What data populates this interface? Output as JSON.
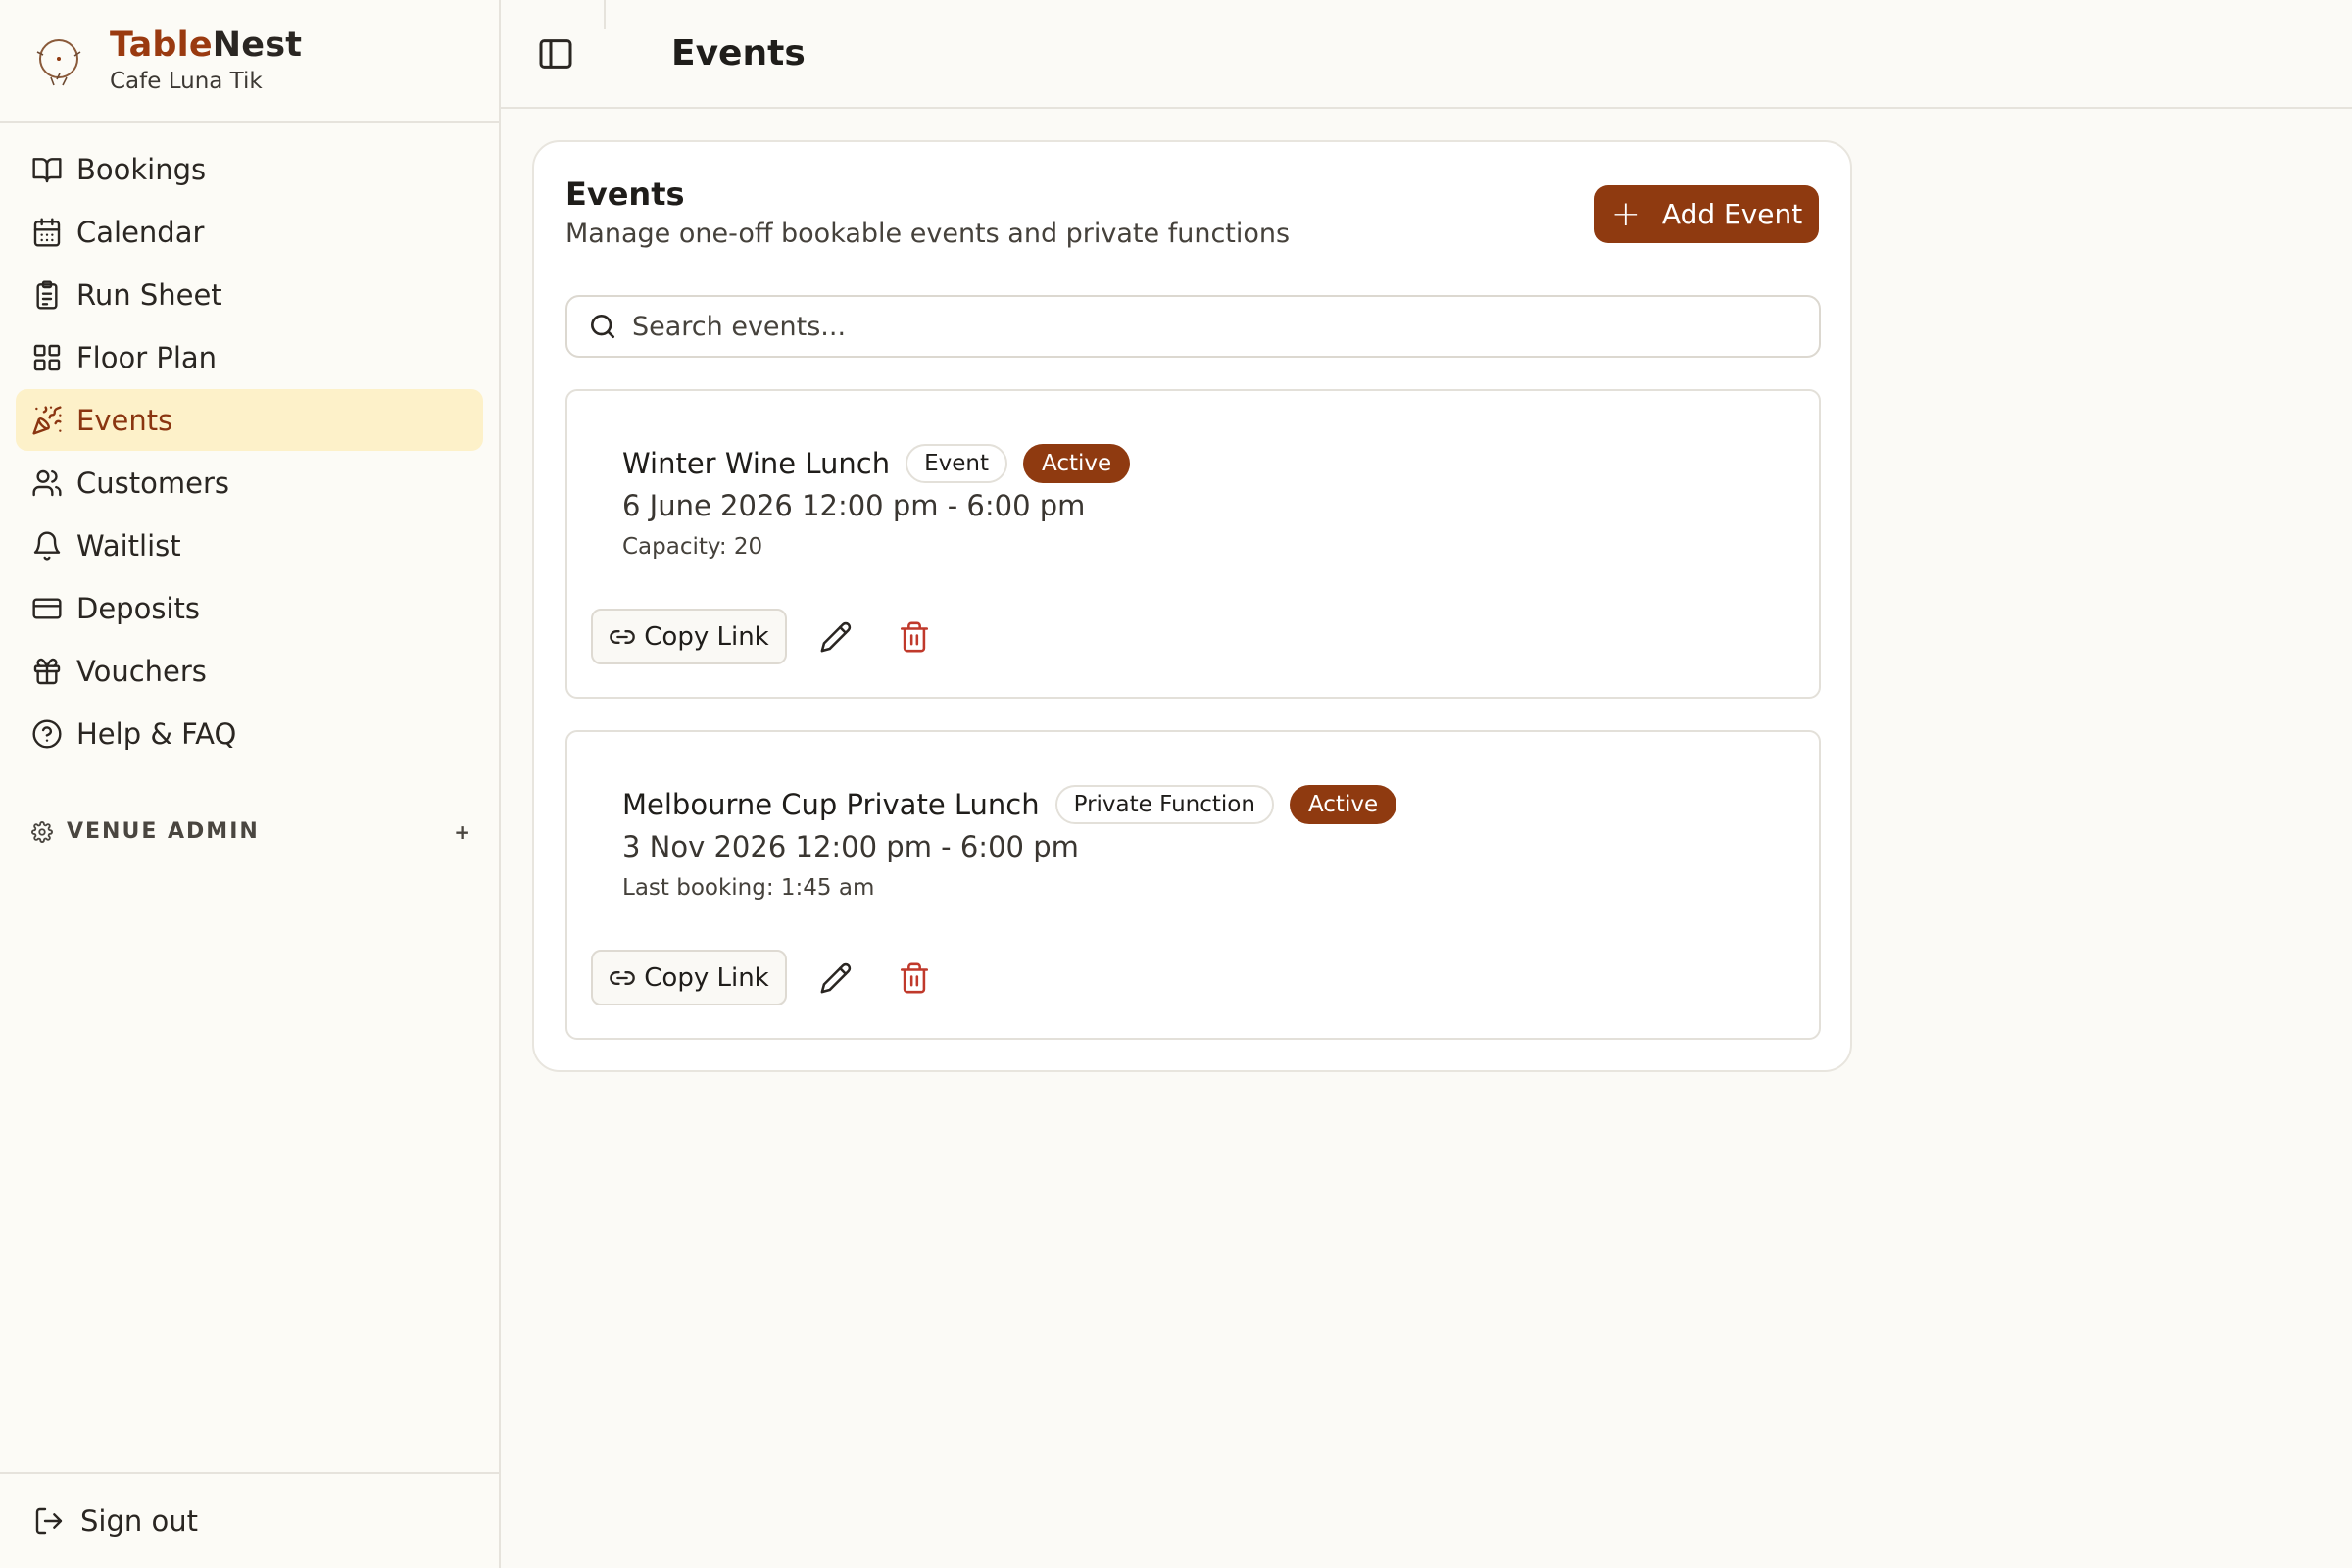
{
  "brand": {
    "name_part1": "Table",
    "name_part2": "Nest",
    "venue": "Cafe Luna Tik"
  },
  "sidebar": {
    "items": [
      {
        "label": "Bookings",
        "icon": "book-open-icon"
      },
      {
        "label": "Calendar",
        "icon": "calendar-icon"
      },
      {
        "label": "Run Sheet",
        "icon": "clipboard-icon"
      },
      {
        "label": "Floor Plan",
        "icon": "grid-icon"
      },
      {
        "label": "Events",
        "icon": "party-popper-icon",
        "active": true
      },
      {
        "label": "Customers",
        "icon": "users-icon"
      },
      {
        "label": "Waitlist",
        "icon": "bell-icon"
      },
      {
        "label": "Deposits",
        "icon": "credit-card-icon"
      },
      {
        "label": "Vouchers",
        "icon": "gift-icon"
      },
      {
        "label": "Help & FAQ",
        "icon": "help-circle-icon"
      }
    ],
    "section_label": "VENUE ADMIN",
    "section_toggle": "+",
    "sign_out": "Sign out"
  },
  "header": {
    "title": "Events"
  },
  "main": {
    "title": "Events",
    "subtitle": "Manage one-off bookable events and private functions",
    "add_button": "Add Event",
    "add_button_icon": "+",
    "search_placeholder": "Search events...",
    "events": [
      {
        "name": "Winter Wine Lunch",
        "type": "Event",
        "status": "Active",
        "date": "6 June 2026 12:00 pm - 6:00 pm",
        "meta": "Capacity: 20",
        "copy_label": "Copy Link"
      },
      {
        "name": "Melbourne Cup Private Lunch",
        "type": "Private Function",
        "status": "Active",
        "date": "3 Nov 2026 12:00 pm - 6:00 pm",
        "meta": "Last booking: 1:45 am",
        "copy_label": "Copy Link"
      }
    ]
  },
  "colors": {
    "accent": "#8f3a10",
    "active_nav_bg": "#fdf1c9",
    "delete": "#c0392b"
  }
}
